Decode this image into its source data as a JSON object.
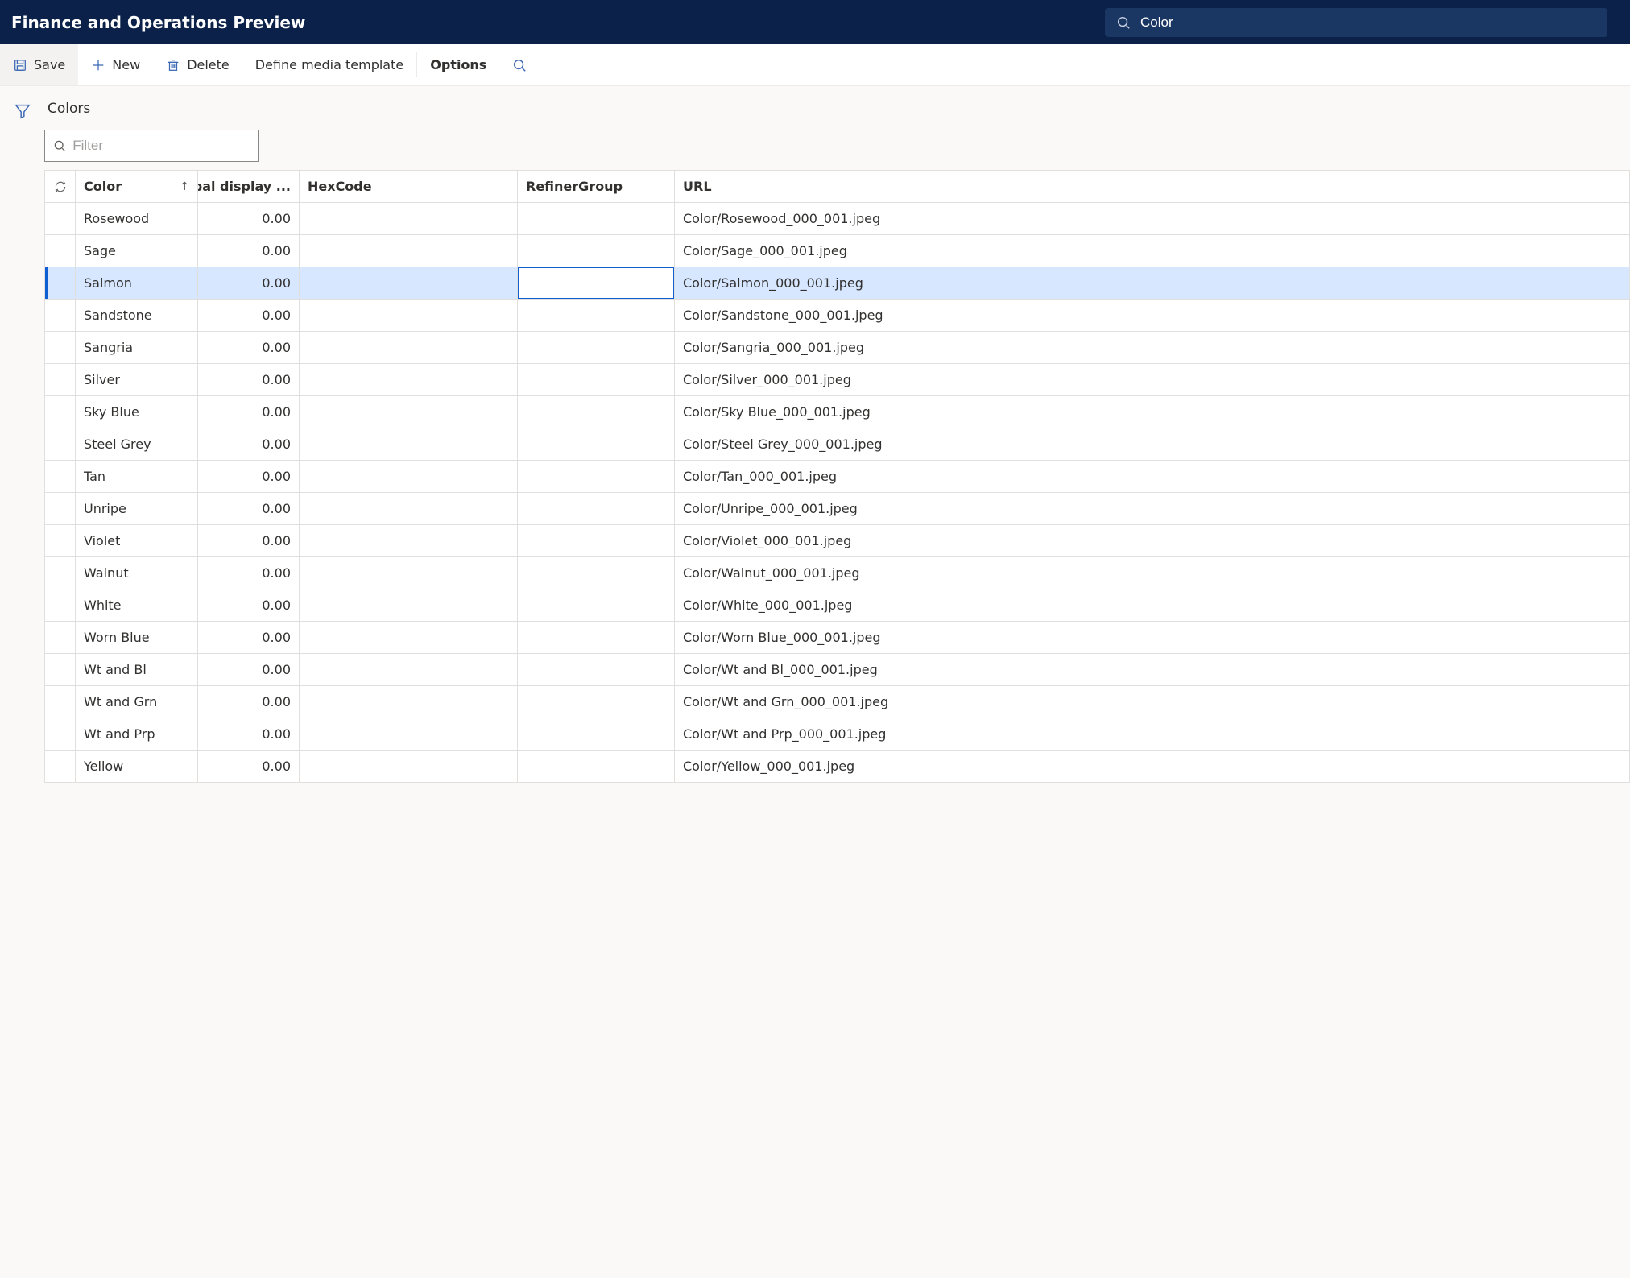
{
  "header": {
    "app_title": "Finance and Operations Preview",
    "search_value": "Color"
  },
  "actions": {
    "save": "Save",
    "new": "New",
    "delete": "Delete",
    "define_media": "Define media template",
    "options": "Options"
  },
  "page": {
    "title": "Colors",
    "filter_placeholder": "Filter"
  },
  "grid": {
    "columns": {
      "color": "Color",
      "display_order": "Global display ...",
      "hex": "HexCode",
      "refiner": "RefinerGroup",
      "url": "URL"
    },
    "sort_asc_on": "color",
    "selected_index": 2,
    "editing_cell_value": "",
    "rows": [
      {
        "color": "Rosewood",
        "display": "0.00",
        "hex": "",
        "refiner": "",
        "url": "Color/Rosewood_000_001.jpeg"
      },
      {
        "color": "Sage",
        "display": "0.00",
        "hex": "",
        "refiner": "",
        "url": "Color/Sage_000_001.jpeg"
      },
      {
        "color": "Salmon",
        "display": "0.00",
        "hex": "",
        "refiner": "",
        "url": "Color/Salmon_000_001.jpeg"
      },
      {
        "color": "Sandstone",
        "display": "0.00",
        "hex": "",
        "refiner": "",
        "url": "Color/Sandstone_000_001.jpeg"
      },
      {
        "color": "Sangria",
        "display": "0.00",
        "hex": "",
        "refiner": "",
        "url": "Color/Sangria_000_001.jpeg"
      },
      {
        "color": "Silver",
        "display": "0.00",
        "hex": "",
        "refiner": "",
        "url": "Color/Silver_000_001.jpeg"
      },
      {
        "color": "Sky Blue",
        "display": "0.00",
        "hex": "",
        "refiner": "",
        "url": "Color/Sky Blue_000_001.jpeg"
      },
      {
        "color": "Steel Grey",
        "display": "0.00",
        "hex": "",
        "refiner": "",
        "url": "Color/Steel Grey_000_001.jpeg"
      },
      {
        "color": "Tan",
        "display": "0.00",
        "hex": "",
        "refiner": "",
        "url": "Color/Tan_000_001.jpeg"
      },
      {
        "color": "Unripe",
        "display": "0.00",
        "hex": "",
        "refiner": "",
        "url": "Color/Unripe_000_001.jpeg"
      },
      {
        "color": "Violet",
        "display": "0.00",
        "hex": "",
        "refiner": "",
        "url": "Color/Violet_000_001.jpeg"
      },
      {
        "color": "Walnut",
        "display": "0.00",
        "hex": "",
        "refiner": "",
        "url": "Color/Walnut_000_001.jpeg"
      },
      {
        "color": "White",
        "display": "0.00",
        "hex": "",
        "refiner": "",
        "url": "Color/White_000_001.jpeg"
      },
      {
        "color": "Worn Blue",
        "display": "0.00",
        "hex": "",
        "refiner": "",
        "url": "Color/Worn Blue_000_001.jpeg"
      },
      {
        "color": "Wt and Bl",
        "display": "0.00",
        "hex": "",
        "refiner": "",
        "url": "Color/Wt and Bl_000_001.jpeg"
      },
      {
        "color": "Wt and Grn",
        "display": "0.00",
        "hex": "",
        "refiner": "",
        "url": "Color/Wt and Grn_000_001.jpeg"
      },
      {
        "color": "Wt and Prp",
        "display": "0.00",
        "hex": "",
        "refiner": "",
        "url": "Color/Wt and Prp_000_001.jpeg"
      },
      {
        "color": "Yellow",
        "display": "0.00",
        "hex": "",
        "refiner": "",
        "url": "Color/Yellow_000_001.jpeg"
      }
    ]
  }
}
